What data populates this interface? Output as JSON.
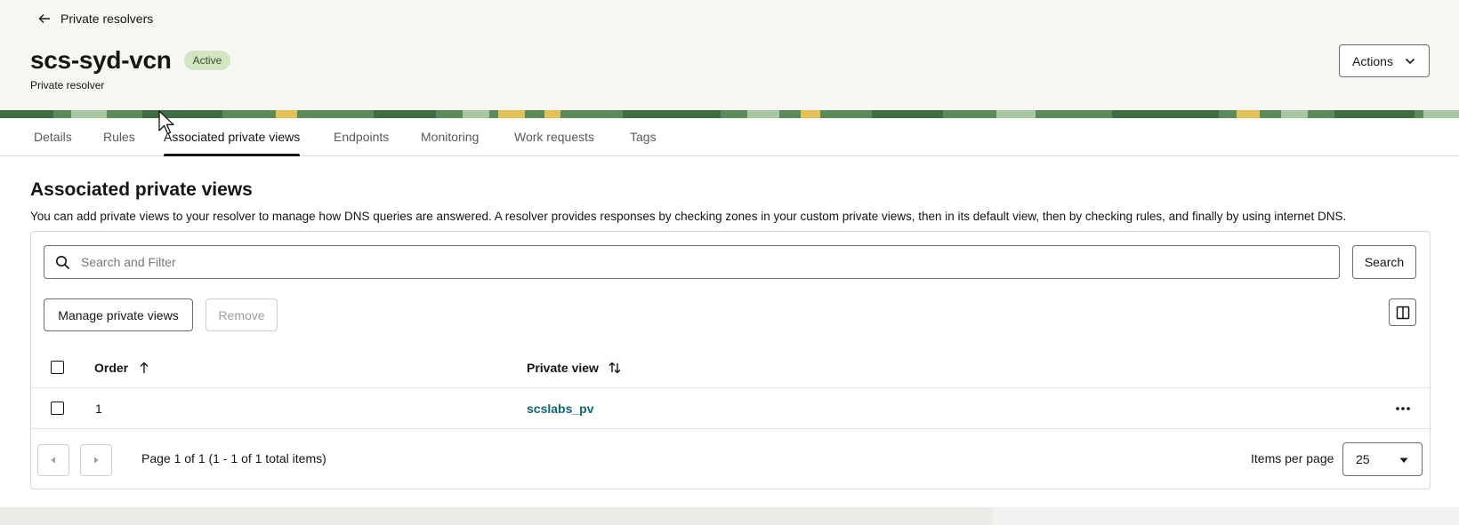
{
  "breadcrumb": {
    "back_label": "Private resolvers"
  },
  "header": {
    "title": "scs-syd-vcn",
    "status": "Active",
    "subtitle": "Private resolver",
    "actions_label": "Actions"
  },
  "tabs": [
    {
      "label": "Details"
    },
    {
      "label": "Rules"
    },
    {
      "label": "Associated private views",
      "active": true
    },
    {
      "label": "Endpoints"
    },
    {
      "label": "Monitoring"
    },
    {
      "label": "Work requests"
    },
    {
      "label": "Tags"
    }
  ],
  "section": {
    "title": "Associated private views",
    "description": "You can add private views to your resolver to manage how DNS queries are answered. A resolver provides responses by checking zones in your custom private views, then in its default view, then by checking rules, and finally by using internet DNS."
  },
  "search": {
    "placeholder": "Search and Filter",
    "button_label": "Search"
  },
  "toolbar": {
    "manage_label": "Manage private views",
    "remove_label": "Remove"
  },
  "table": {
    "columns": [
      {
        "label": "Order"
      },
      {
        "label": "Private view"
      }
    ],
    "rows": [
      {
        "order": "1",
        "private_view": "scslabs_pv"
      }
    ]
  },
  "pagination": {
    "info": "Page 1 of 1 (1 - 1 of 1 total items)",
    "items_per_page_label": "Items per page",
    "items_per_page": "25"
  },
  "colors": {
    "accent_link": "#13656f",
    "status_badge_bg": "#d3e5c3",
    "text": "#161513"
  }
}
